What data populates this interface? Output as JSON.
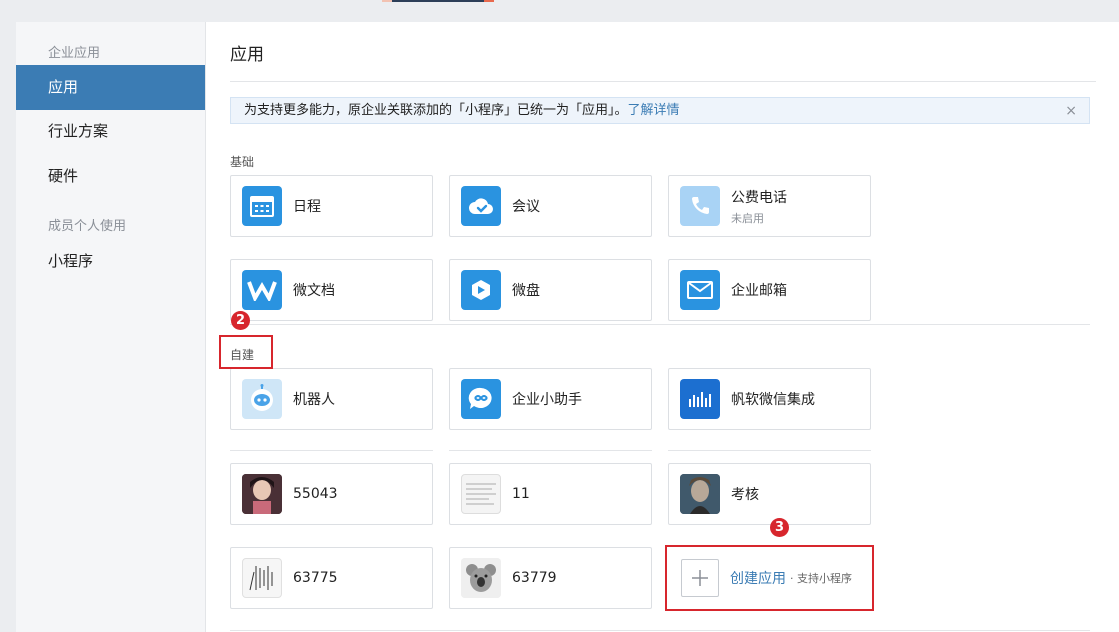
{
  "sidebar": {
    "group_enterprise": "企业应用",
    "items_enterprise": [
      "应用",
      "行业方案",
      "硬件"
    ],
    "group_member": "成员个人使用",
    "items_member": [
      "小程序"
    ]
  },
  "main": {
    "title": "应用",
    "notice": {
      "text": "为支持更多能力，原企业关联添加的「小程序」已统一为「应用」。",
      "link": "了解详情",
      "close": "×"
    },
    "sections": {
      "basic": "基础",
      "custom": "自建"
    },
    "basic_apps": [
      {
        "name": "日程",
        "icon": "calendar-icon",
        "color": "#2a93e0"
      },
      {
        "name": "会议",
        "icon": "cloud-meeting-icon",
        "color": "#2a93e0"
      },
      {
        "name": "公费电话",
        "sub": "未启用",
        "icon": "phone-icon",
        "color": "#a9d3f5"
      },
      {
        "name": "微文档",
        "icon": "doc-w-icon",
        "color": "#2a93e0"
      },
      {
        "name": "微盘",
        "icon": "drive-icon",
        "color": "#2a93e0"
      },
      {
        "name": "企业邮箱",
        "icon": "mail-icon",
        "color": "#2a93e0"
      }
    ],
    "custom_apps": [
      {
        "name": "机器人",
        "icon": "robot-icon"
      },
      {
        "name": "企业小助手",
        "icon": "assistant-icon"
      },
      {
        "name": "帆软微信集成",
        "icon": "fanruan-icon"
      },
      {
        "name": "55043",
        "icon": "avatar-thumbnail-icon"
      },
      {
        "name": "11",
        "icon": "document-thumbnail-icon"
      },
      {
        "name": "考核",
        "icon": "photo-thumbnail-icon"
      },
      {
        "name": "63775",
        "icon": "sketch-thumbnail-icon"
      },
      {
        "name": "63779",
        "icon": "koala-thumbnail-icon"
      }
    ],
    "create": {
      "label": "创建应用",
      "sub": "· 支持小程序"
    }
  },
  "annotations": {
    "badge_2": "2",
    "badge_3": "3",
    "color": "#d7262d"
  }
}
